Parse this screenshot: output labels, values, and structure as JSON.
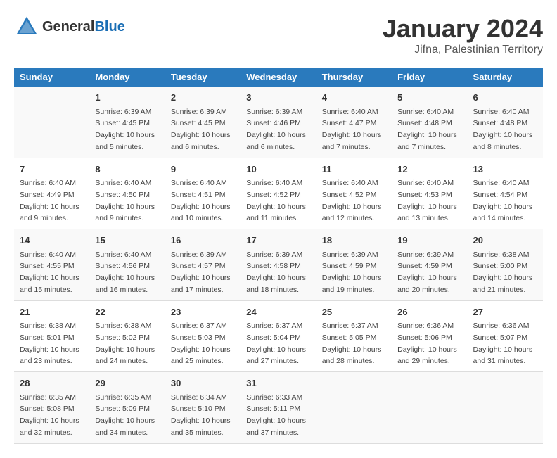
{
  "header": {
    "logo_general": "General",
    "logo_blue": "Blue",
    "month_title": "January 2024",
    "location": "Jifna, Palestinian Territory"
  },
  "days_of_week": [
    "Sunday",
    "Monday",
    "Tuesday",
    "Wednesday",
    "Thursday",
    "Friday",
    "Saturday"
  ],
  "weeks": [
    [
      {
        "day": "",
        "info": ""
      },
      {
        "day": "1",
        "info": "Sunrise: 6:39 AM\nSunset: 4:45 PM\nDaylight: 10 hours\nand 5 minutes."
      },
      {
        "day": "2",
        "info": "Sunrise: 6:39 AM\nSunset: 4:45 PM\nDaylight: 10 hours\nand 6 minutes."
      },
      {
        "day": "3",
        "info": "Sunrise: 6:39 AM\nSunset: 4:46 PM\nDaylight: 10 hours\nand 6 minutes."
      },
      {
        "day": "4",
        "info": "Sunrise: 6:40 AM\nSunset: 4:47 PM\nDaylight: 10 hours\nand 7 minutes."
      },
      {
        "day": "5",
        "info": "Sunrise: 6:40 AM\nSunset: 4:48 PM\nDaylight: 10 hours\nand 7 minutes."
      },
      {
        "day": "6",
        "info": "Sunrise: 6:40 AM\nSunset: 4:48 PM\nDaylight: 10 hours\nand 8 minutes."
      }
    ],
    [
      {
        "day": "7",
        "info": "Sunrise: 6:40 AM\nSunset: 4:49 PM\nDaylight: 10 hours\nand 9 minutes."
      },
      {
        "day": "8",
        "info": "Sunrise: 6:40 AM\nSunset: 4:50 PM\nDaylight: 10 hours\nand 9 minutes."
      },
      {
        "day": "9",
        "info": "Sunrise: 6:40 AM\nSunset: 4:51 PM\nDaylight: 10 hours\nand 10 minutes."
      },
      {
        "day": "10",
        "info": "Sunrise: 6:40 AM\nSunset: 4:52 PM\nDaylight: 10 hours\nand 11 minutes."
      },
      {
        "day": "11",
        "info": "Sunrise: 6:40 AM\nSunset: 4:52 PM\nDaylight: 10 hours\nand 12 minutes."
      },
      {
        "day": "12",
        "info": "Sunrise: 6:40 AM\nSunset: 4:53 PM\nDaylight: 10 hours\nand 13 minutes."
      },
      {
        "day": "13",
        "info": "Sunrise: 6:40 AM\nSunset: 4:54 PM\nDaylight: 10 hours\nand 14 minutes."
      }
    ],
    [
      {
        "day": "14",
        "info": "Sunrise: 6:40 AM\nSunset: 4:55 PM\nDaylight: 10 hours\nand 15 minutes."
      },
      {
        "day": "15",
        "info": "Sunrise: 6:40 AM\nSunset: 4:56 PM\nDaylight: 10 hours\nand 16 minutes."
      },
      {
        "day": "16",
        "info": "Sunrise: 6:39 AM\nSunset: 4:57 PM\nDaylight: 10 hours\nand 17 minutes."
      },
      {
        "day": "17",
        "info": "Sunrise: 6:39 AM\nSunset: 4:58 PM\nDaylight: 10 hours\nand 18 minutes."
      },
      {
        "day": "18",
        "info": "Sunrise: 6:39 AM\nSunset: 4:59 PM\nDaylight: 10 hours\nand 19 minutes."
      },
      {
        "day": "19",
        "info": "Sunrise: 6:39 AM\nSunset: 4:59 PM\nDaylight: 10 hours\nand 20 minutes."
      },
      {
        "day": "20",
        "info": "Sunrise: 6:38 AM\nSunset: 5:00 PM\nDaylight: 10 hours\nand 21 minutes."
      }
    ],
    [
      {
        "day": "21",
        "info": "Sunrise: 6:38 AM\nSunset: 5:01 PM\nDaylight: 10 hours\nand 23 minutes."
      },
      {
        "day": "22",
        "info": "Sunrise: 6:38 AM\nSunset: 5:02 PM\nDaylight: 10 hours\nand 24 minutes."
      },
      {
        "day": "23",
        "info": "Sunrise: 6:37 AM\nSunset: 5:03 PM\nDaylight: 10 hours\nand 25 minutes."
      },
      {
        "day": "24",
        "info": "Sunrise: 6:37 AM\nSunset: 5:04 PM\nDaylight: 10 hours\nand 27 minutes."
      },
      {
        "day": "25",
        "info": "Sunrise: 6:37 AM\nSunset: 5:05 PM\nDaylight: 10 hours\nand 28 minutes."
      },
      {
        "day": "26",
        "info": "Sunrise: 6:36 AM\nSunset: 5:06 PM\nDaylight: 10 hours\nand 29 minutes."
      },
      {
        "day": "27",
        "info": "Sunrise: 6:36 AM\nSunset: 5:07 PM\nDaylight: 10 hours\nand 31 minutes."
      }
    ],
    [
      {
        "day": "28",
        "info": "Sunrise: 6:35 AM\nSunset: 5:08 PM\nDaylight: 10 hours\nand 32 minutes."
      },
      {
        "day": "29",
        "info": "Sunrise: 6:35 AM\nSunset: 5:09 PM\nDaylight: 10 hours\nand 34 minutes."
      },
      {
        "day": "30",
        "info": "Sunrise: 6:34 AM\nSunset: 5:10 PM\nDaylight: 10 hours\nand 35 minutes."
      },
      {
        "day": "31",
        "info": "Sunrise: 6:33 AM\nSunset: 5:11 PM\nDaylight: 10 hours\nand 37 minutes."
      },
      {
        "day": "",
        "info": ""
      },
      {
        "day": "",
        "info": ""
      },
      {
        "day": "",
        "info": ""
      }
    ]
  ]
}
